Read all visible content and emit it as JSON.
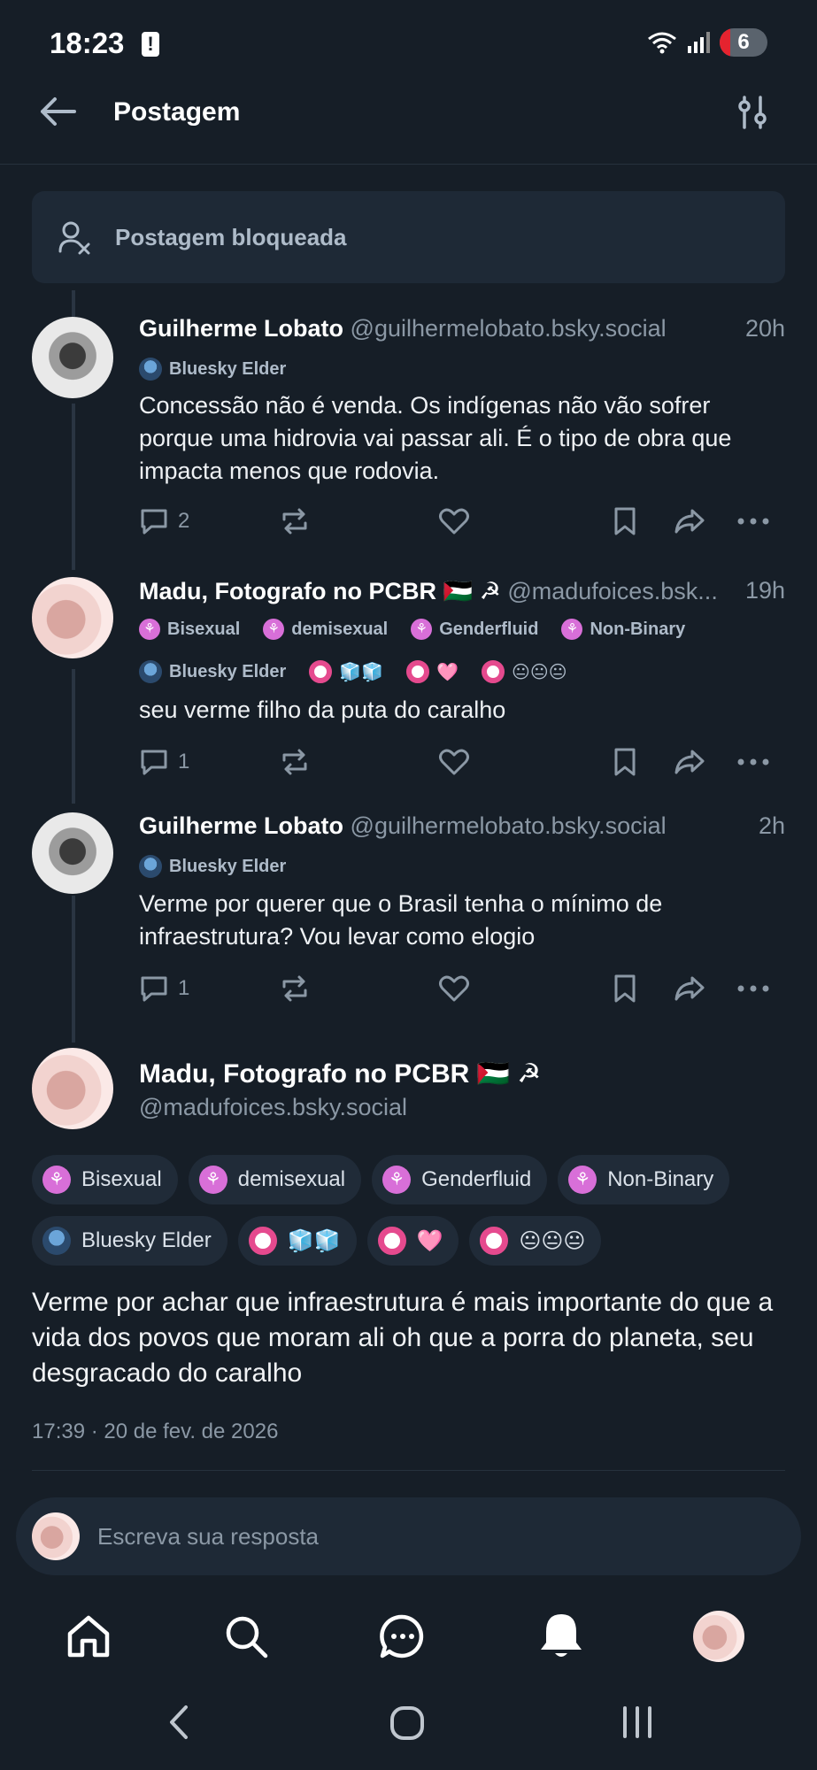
{
  "status_bar": {
    "time": "18:23",
    "alert_glyph": "!",
    "battery_level": "6",
    "icons": [
      "wifi-icon",
      "signal-icon",
      "battery-icon"
    ]
  },
  "header": {
    "title": "Postagem",
    "back_icon": "arrow-left-icon",
    "filter_icon": "sliders-icon"
  },
  "blocked": {
    "label": "Postagem bloqueada"
  },
  "posts": [
    {
      "name": "Guilherme Lobato",
      "handle": "@guilhermelobato.bsky.social",
      "time": "20h",
      "badges_row1": [
        {
          "label": "Bluesky Elder",
          "kind": "elder"
        }
      ],
      "body": "Concessão não é venda. Os indígenas não vão sofrer porque uma hidrovia vai passar ali. É o tipo de obra que impacta menos que rodovia.",
      "reply_count": "2"
    },
    {
      "name": "Madu, Fotografo no PCBR 🇵🇸 ☭",
      "handle": "@madufoices.bsk...",
      "time": "19h",
      "badges_row1": [
        {
          "label": "Bisexual",
          "kind": "flower"
        },
        {
          "label": "demisexual",
          "kind": "flower"
        },
        {
          "label": "Genderfluid",
          "kind": "flower"
        },
        {
          "label": "Non-Binary",
          "kind": "flower"
        }
      ],
      "badges_row2": [
        {
          "label": "Bluesky Elder",
          "kind": "elder"
        },
        {
          "label": "🧊🧊",
          "kind": "ring"
        },
        {
          "label": "🩷",
          "kind": "ring"
        },
        {
          "label": "😐😐😐",
          "kind": "ring"
        }
      ],
      "body": "seu verme filho da puta do caralho",
      "reply_count": "1"
    },
    {
      "name": "Guilherme Lobato",
      "handle": "@guilhermelobato.bsky.social",
      "time": "2h",
      "badges_row1": [
        {
          "label": "Bluesky Elder",
          "kind": "elder"
        }
      ],
      "body": "Verme por querer que o Brasil tenha o mínimo de infraestrutura? Vou levar como elogio",
      "reply_count": "1"
    }
  ],
  "main_post": {
    "name": "Madu, Fotografo no PCBR 🇵🇸 ☭",
    "handle": "@madufoices.bsky.social",
    "chips_row1": [
      "Bisexual",
      "demisexual",
      "Genderfluid",
      "Non-Binary"
    ],
    "chips_row2": [
      "Bluesky Elder",
      "🧊🧊",
      "🩷",
      "😐😐😐"
    ],
    "body": "Verme por achar que infraestrutura é mais importante do que a vida dos povos que moram ali oh que a porra do planeta, seu desgracado do caralho",
    "date": "17:39 · 20 de fev. de 2026"
  },
  "reply": {
    "placeholder": "Escreva sua resposta"
  },
  "bottom_nav": [
    "home-icon",
    "search-icon",
    "chat-icon",
    "notifications-icon",
    "profile-avatar"
  ],
  "colors": {
    "background": "#161e27",
    "card": "#1e2936",
    "muted_text": "#8b98a5",
    "badge_pink": "#d86fd8"
  }
}
